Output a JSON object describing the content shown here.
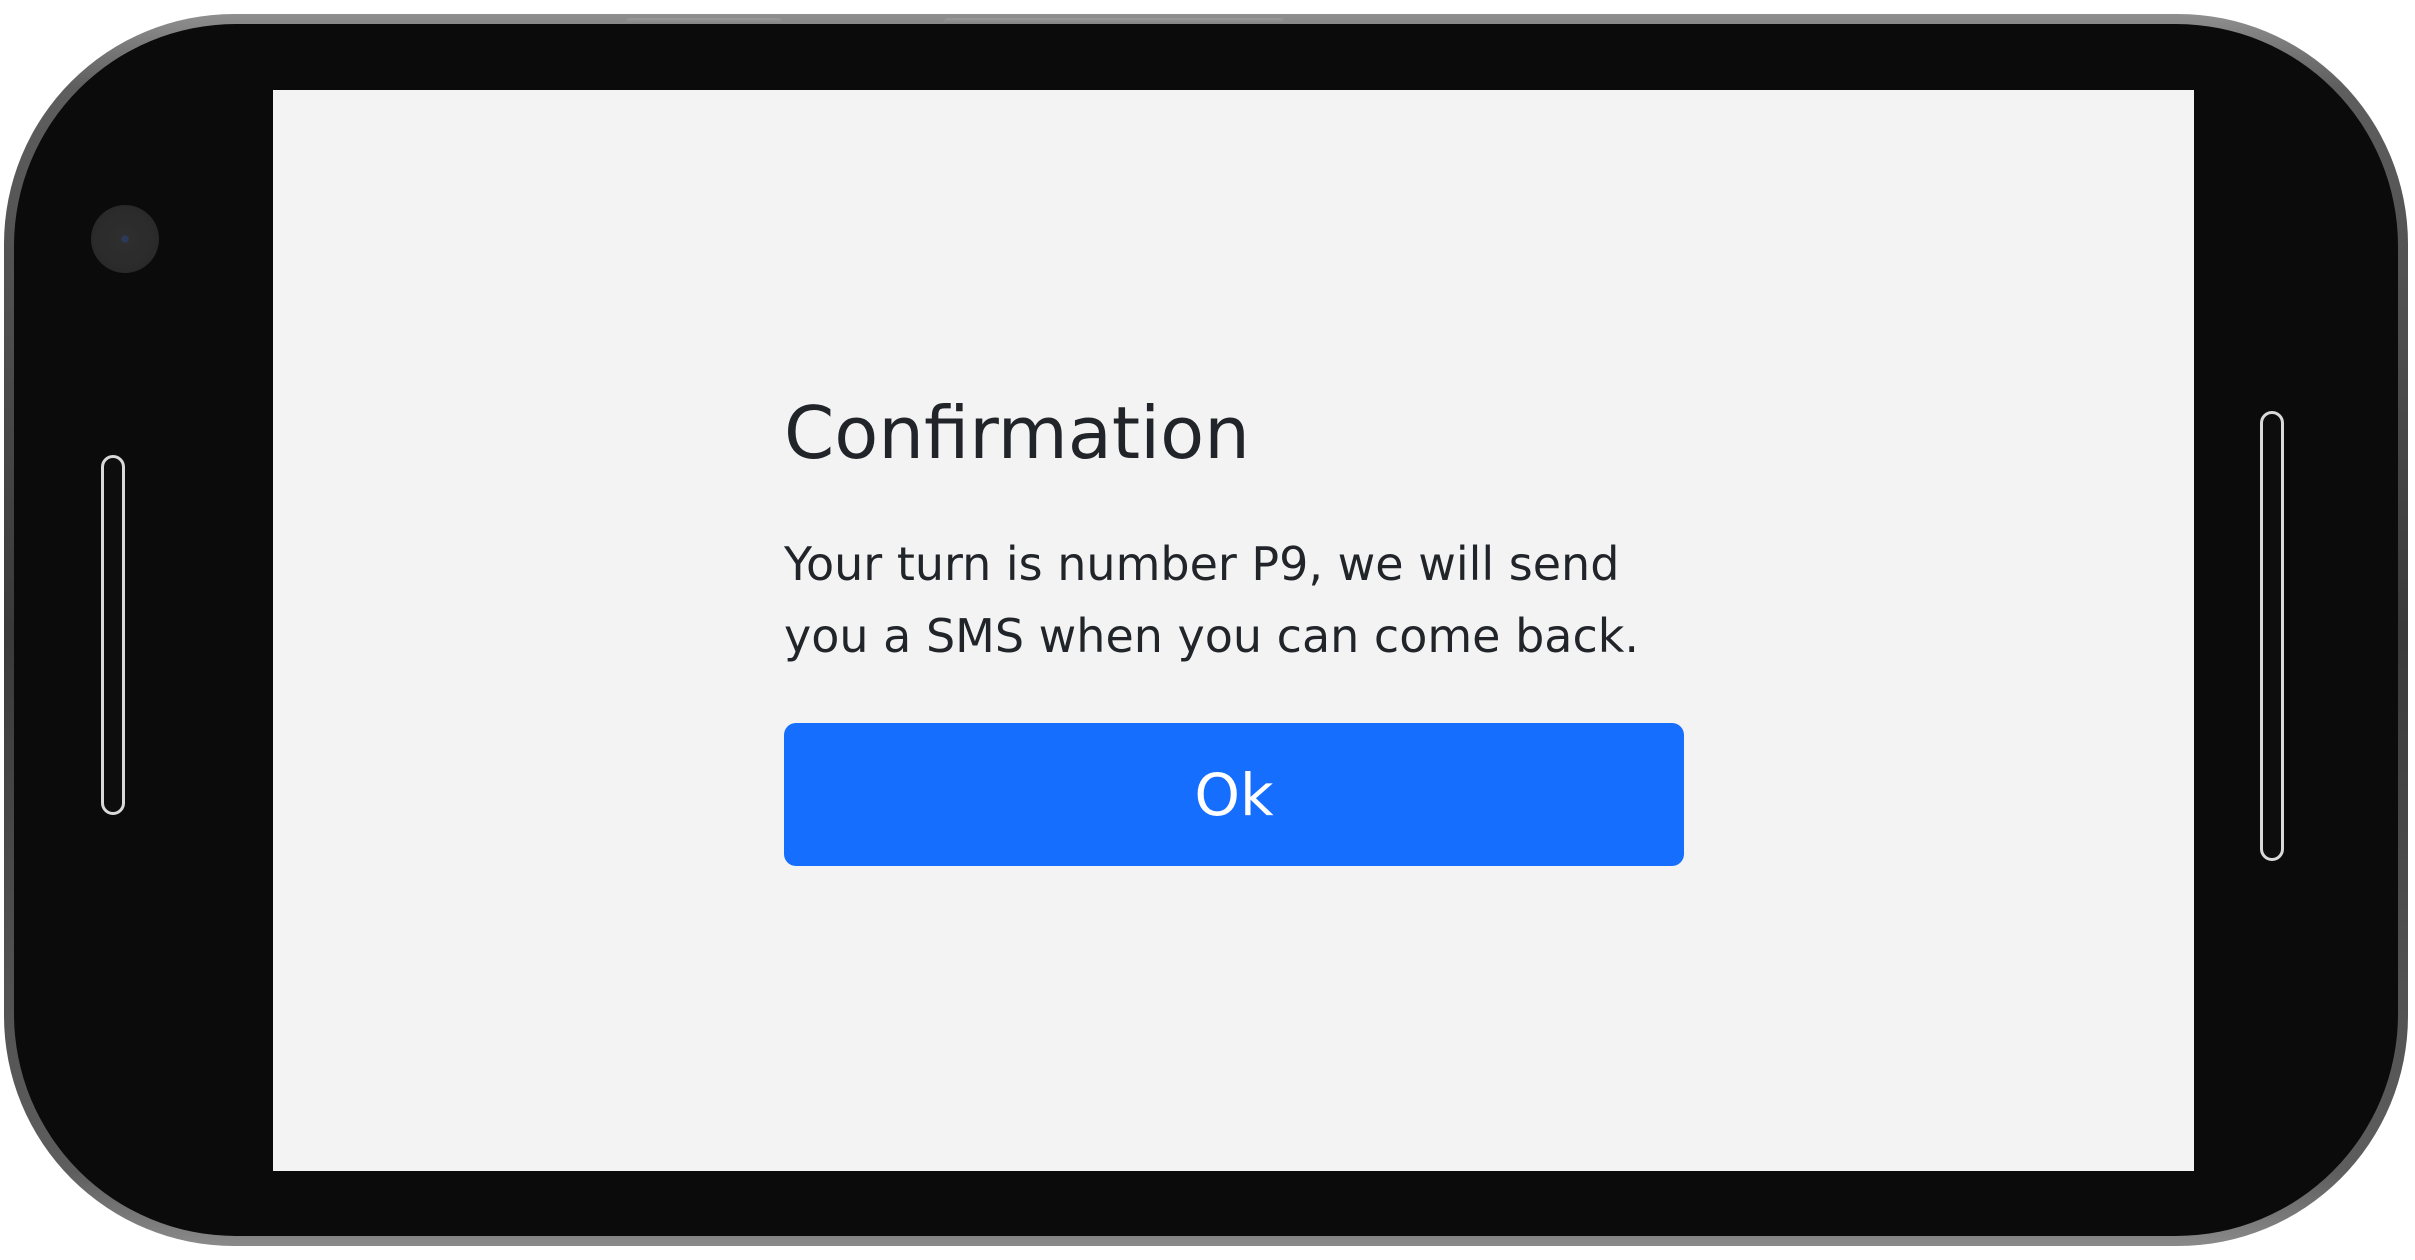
{
  "dialog": {
    "title": "Confirmation",
    "message": "Your turn is number P9, we will send you a SMS when you can come back.",
    "ok_label": "Ok"
  },
  "colors": {
    "screen_background": "#f3f3f4",
    "primary_button": "#156efe",
    "text": "#212529",
    "device_frame": "#0b0b0b"
  }
}
